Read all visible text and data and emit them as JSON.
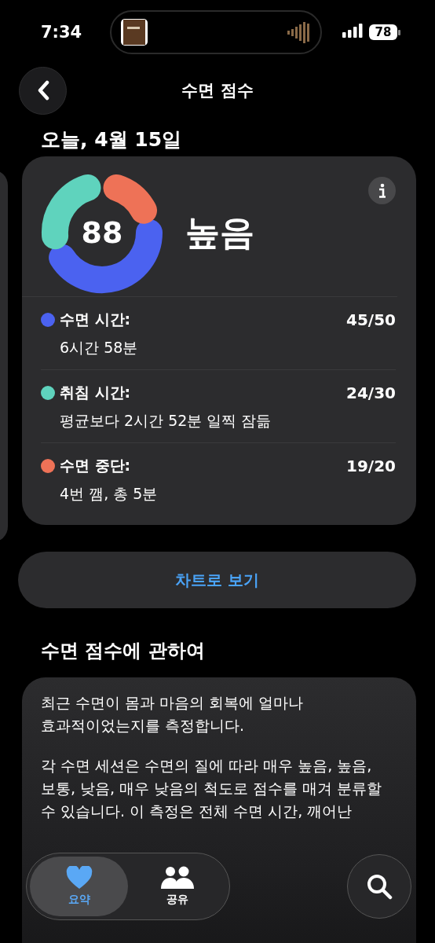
{
  "status_bar": {
    "time": "7:34",
    "battery": "78"
  },
  "nav": {
    "title": "수면 점수"
  },
  "date": "오늘, 4월 15일",
  "score": {
    "value": "88",
    "rating": "높음"
  },
  "metrics": [
    {
      "label": "수면 시간:",
      "detail": "6시간 58분",
      "points": "45/50",
      "color": "#4b62f0"
    },
    {
      "label": "취침 시간:",
      "detail": "평균보다 2시간 52분 일찍 잠듦",
      "points": "24/30",
      "color": "#5fd3bd"
    },
    {
      "label": "수면 중단:",
      "detail": "4번 깸, 총 5분",
      "points": "19/20",
      "color": "#ee7257"
    }
  ],
  "chart_button": "차트로 보기",
  "about": {
    "title": "수면 점수에 관하여",
    "paragraphs": [
      "최근 수면이 몸과 마음의 회복에 얼마나 효과적이었는지를 측정합니다.",
      "각 수면 세션은 수면의 질에 따라 매우 높음, 높음, 보통, 낮음, 매우 낮음의 척도로 점수를 매겨 분류할 수 있습니다. 이 측정은 전체 수면 시간, 깨어난"
    ]
  },
  "tabs": [
    {
      "label": "요약",
      "selected": true
    },
    {
      "label": "공유",
      "selected": false
    }
  ]
}
